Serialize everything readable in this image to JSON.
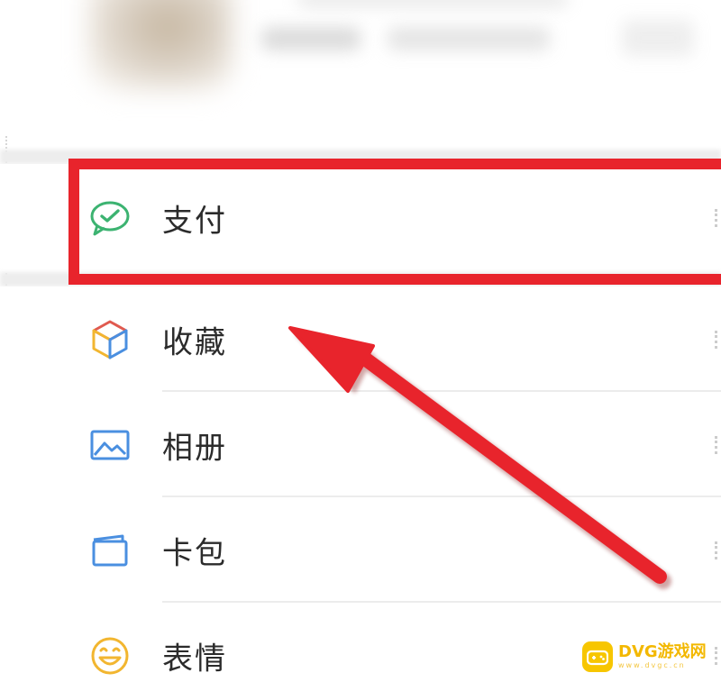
{
  "menu": {
    "items": [
      {
        "id": "pay",
        "label": "支付",
        "icon": "wechat-pay-icon"
      },
      {
        "id": "favorites",
        "label": "收藏",
        "icon": "cube-icon"
      },
      {
        "id": "album",
        "label": "相册",
        "icon": "photo-icon"
      },
      {
        "id": "cards",
        "label": "卡包",
        "icon": "wallet-icon"
      },
      {
        "id": "stickers",
        "label": "表情",
        "icon": "smiley-icon"
      }
    ]
  },
  "annotation": {
    "highlight_color": "#e8242c",
    "arrow_color": "#e8242c"
  },
  "watermark": {
    "title": "DVG游戏网",
    "subtitle": "www.dvgc.cn"
  },
  "colors": {
    "pay_icon": "#3cb371",
    "cube_red": "#e05a4f",
    "cube_yellow": "#f2b630",
    "cube_blue": "#4a8fe0",
    "photo_icon": "#4a8fe0",
    "wallet_icon": "#4a8fe0",
    "smiley_icon": "#f2b630"
  }
}
